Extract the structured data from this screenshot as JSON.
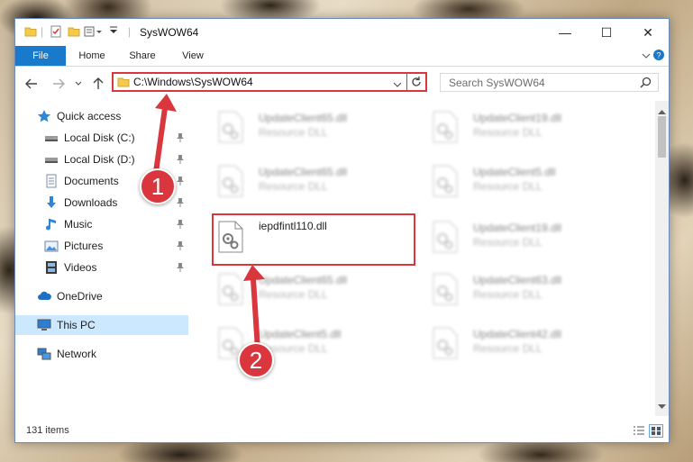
{
  "window": {
    "title": "SysWOW64"
  },
  "controls": {
    "minimize": "—",
    "maximize": "☐",
    "close": "✕"
  },
  "ribbon": {
    "tabs": [
      "File",
      "Home",
      "Share",
      "View"
    ]
  },
  "address": {
    "path": "C:\\Windows\\SysWOW64"
  },
  "search": {
    "placeholder": "Search SysWOW64"
  },
  "sidebar": {
    "items": [
      {
        "label": "Quick access",
        "icon": "star-icon"
      },
      {
        "label": "Local Disk (C:)",
        "icon": "drive-icon"
      },
      {
        "label": "Local Disk (D:)",
        "icon": "drive-icon"
      },
      {
        "label": "Documents",
        "icon": "documents-icon"
      },
      {
        "label": "Downloads",
        "icon": "download-icon"
      },
      {
        "label": "Music",
        "icon": "music-icon"
      },
      {
        "label": "Pictures",
        "icon": "pictures-icon"
      },
      {
        "label": "Videos",
        "icon": "videos-icon"
      },
      {
        "label": "OneDrive",
        "icon": "cloud-icon"
      },
      {
        "label": "This PC",
        "icon": "computer-icon"
      },
      {
        "label": "Network",
        "icon": "network-icon"
      }
    ]
  },
  "files": [
    {
      "name": "UpdateClient65.dll",
      "type": "Resource DLL"
    },
    {
      "name": "UpdateClient19.dll",
      "type": "Resource DLL"
    },
    {
      "name": "UpdateClient65.dll",
      "type": "Resource DLL"
    },
    {
      "name": "UpdateClient5.dll",
      "type": "Resource DLL"
    },
    {
      "name": "iepdfintl110.dll",
      "type": ""
    },
    {
      "name": "UpdateClient19.dll",
      "type": "Resource DLL"
    },
    {
      "name": "UpdateClient65.dll",
      "type": "Resource DLL"
    },
    {
      "name": "UpdateClient63.dll",
      "type": "Resource DLL"
    },
    {
      "name": "UpdateClient5.dll",
      "type": "Resource DLL"
    },
    {
      "name": "UpdateClient42.dll",
      "type": "Resource DLL"
    }
  ],
  "status": {
    "count": "131 items"
  },
  "callouts": {
    "one": "1",
    "two": "2"
  },
  "colors": {
    "accent": "#1979ca",
    "highlight": "#d9363e",
    "selected": "#cce8ff"
  }
}
